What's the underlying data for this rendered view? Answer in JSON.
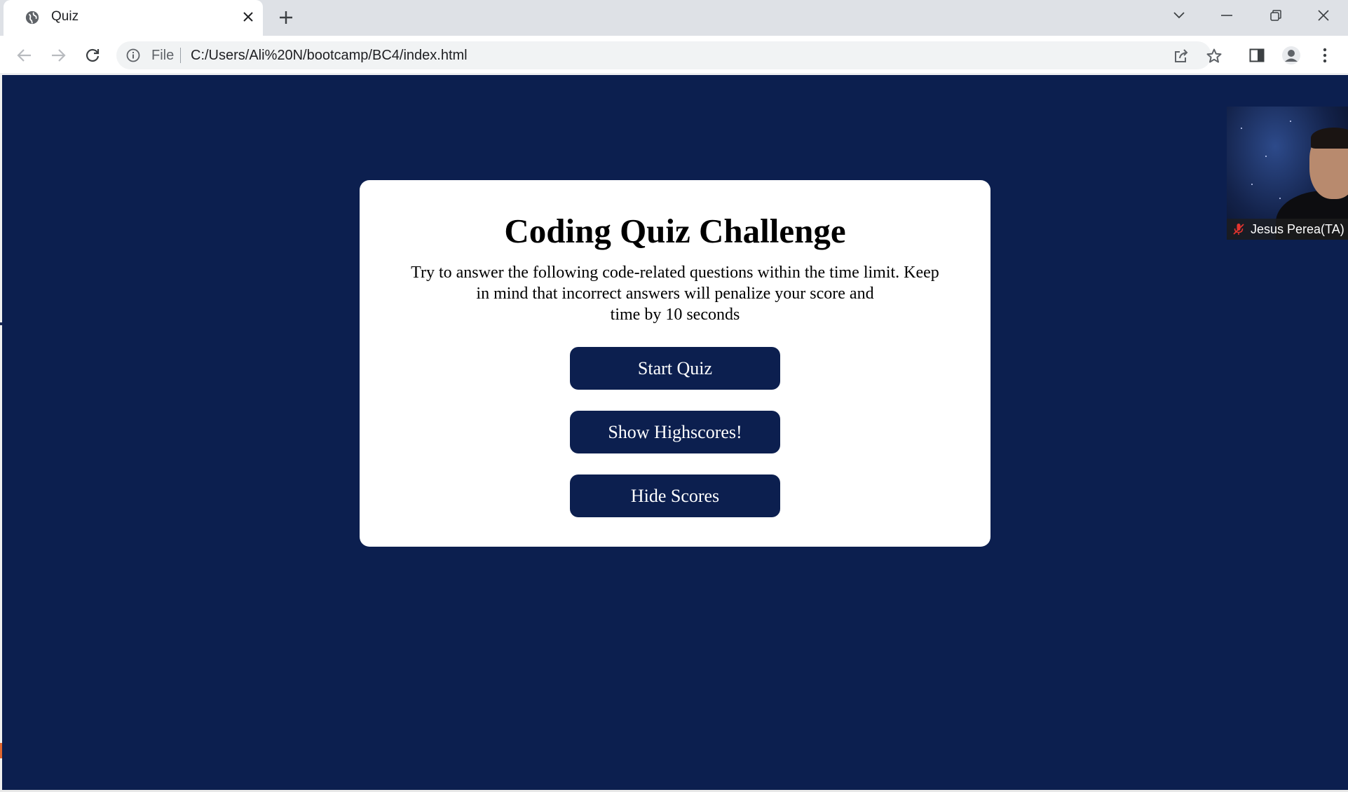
{
  "tab": {
    "title": "Quiz"
  },
  "address": {
    "scheme": "File",
    "url": "C:/Users/Ali%20N/bootcamp/BC4/index.html"
  },
  "quiz": {
    "title": "Coding Quiz Challenge",
    "description_lines": [
      "Try to answer the following code-related questions within the time limit. Keep",
      "in mind that incorrect answers will penalize your score and",
      "time by 10 seconds"
    ],
    "buttons": {
      "start": "Start Quiz",
      "show_highscores": "Show Highscores!",
      "hide_scores": "Hide Scores"
    }
  },
  "video": {
    "participant_name": "Jesus Perea(TA)"
  },
  "colors": {
    "page_bg": "#0c1f4f",
    "button_bg": "#0c1f4f",
    "card_bg": "#ffffff"
  },
  "icons": [
    "globe-icon",
    "close-icon",
    "plus-icon",
    "chevron-down-icon",
    "minimize-icon",
    "restore-icon",
    "window-close-icon",
    "back-icon",
    "forward-icon",
    "reload-icon",
    "info-icon",
    "share-icon",
    "star-icon",
    "side-panel-icon",
    "profile-icon",
    "kebab-menu-icon",
    "mic-off-icon"
  ]
}
